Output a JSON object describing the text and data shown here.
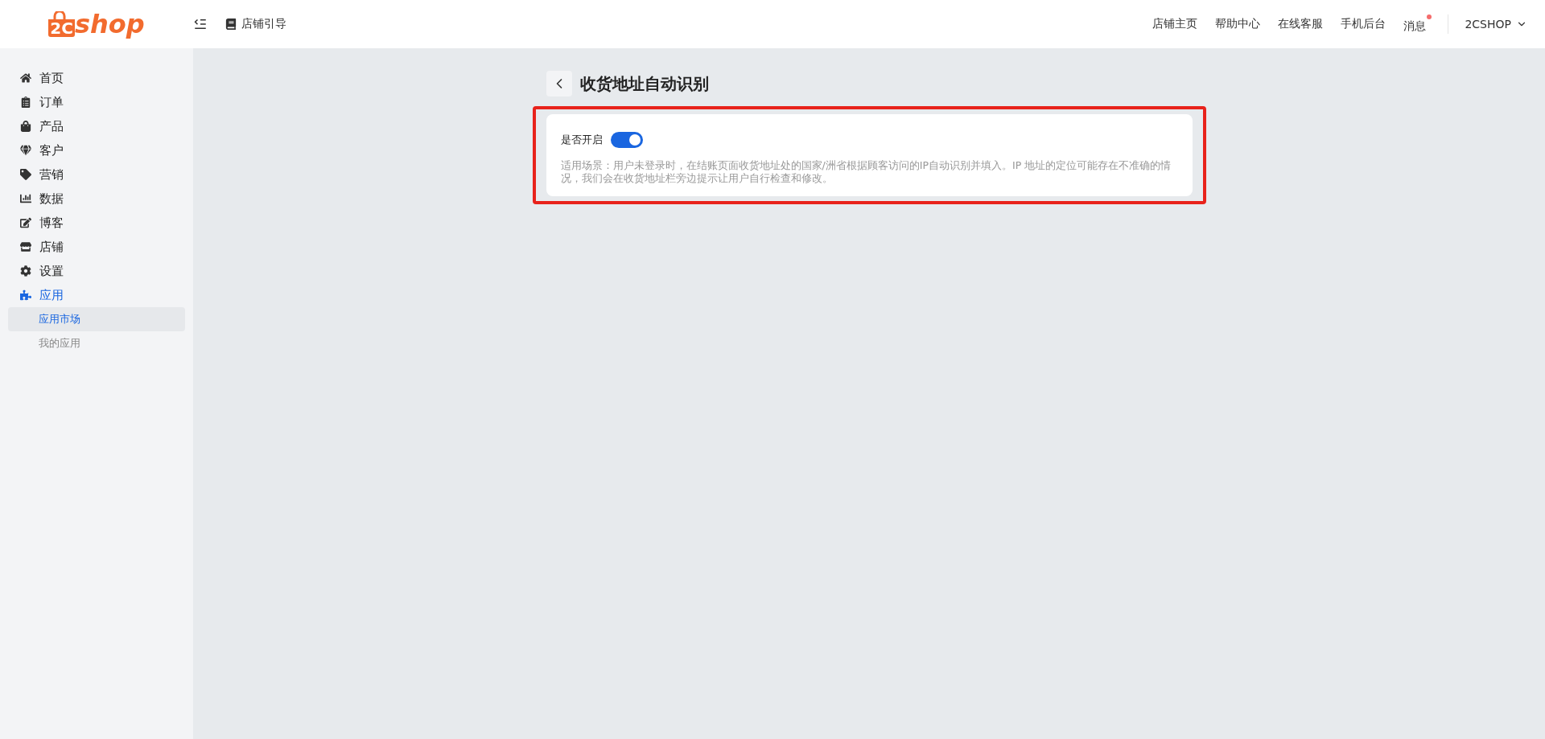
{
  "header": {
    "logo": {
      "mark": "2C",
      "word": "shop"
    },
    "guide_link": "店铺引导",
    "nav_links": [
      "店铺主页",
      "帮助中心",
      "在线客服",
      "手机后台"
    ],
    "messages": {
      "label": "消息",
      "unread": true
    },
    "account": "2CSHOP"
  },
  "sidebar": {
    "items": [
      {
        "label": "首页",
        "selected": false
      },
      {
        "label": "订单",
        "selected": false
      },
      {
        "label": "产品",
        "selected": false
      },
      {
        "label": "客户",
        "selected": false
      },
      {
        "label": "营销",
        "selected": false
      },
      {
        "label": "数据",
        "selected": false
      },
      {
        "label": "博客",
        "selected": false
      },
      {
        "label": "店铺",
        "selected": false
      },
      {
        "label": "设置",
        "selected": false
      },
      {
        "label": "应用",
        "selected": true,
        "expanded": true,
        "children": [
          {
            "label": "应用市场",
            "selected": true
          },
          {
            "label": "我的应用",
            "selected": false
          }
        ]
      }
    ]
  },
  "page": {
    "title": "收货地址自动识别",
    "highlighted": true,
    "setting": {
      "label": "是否开启",
      "on": true,
      "description": "适用场景：用户未登录时，在结账页面收货地址处的国家/洲省根据顾客访问的IP自动识别并填入。IP 地址的定位可能存在不准确的情况，我们会在收货地址栏旁边提示让用户自行检查和修改。"
    }
  }
}
